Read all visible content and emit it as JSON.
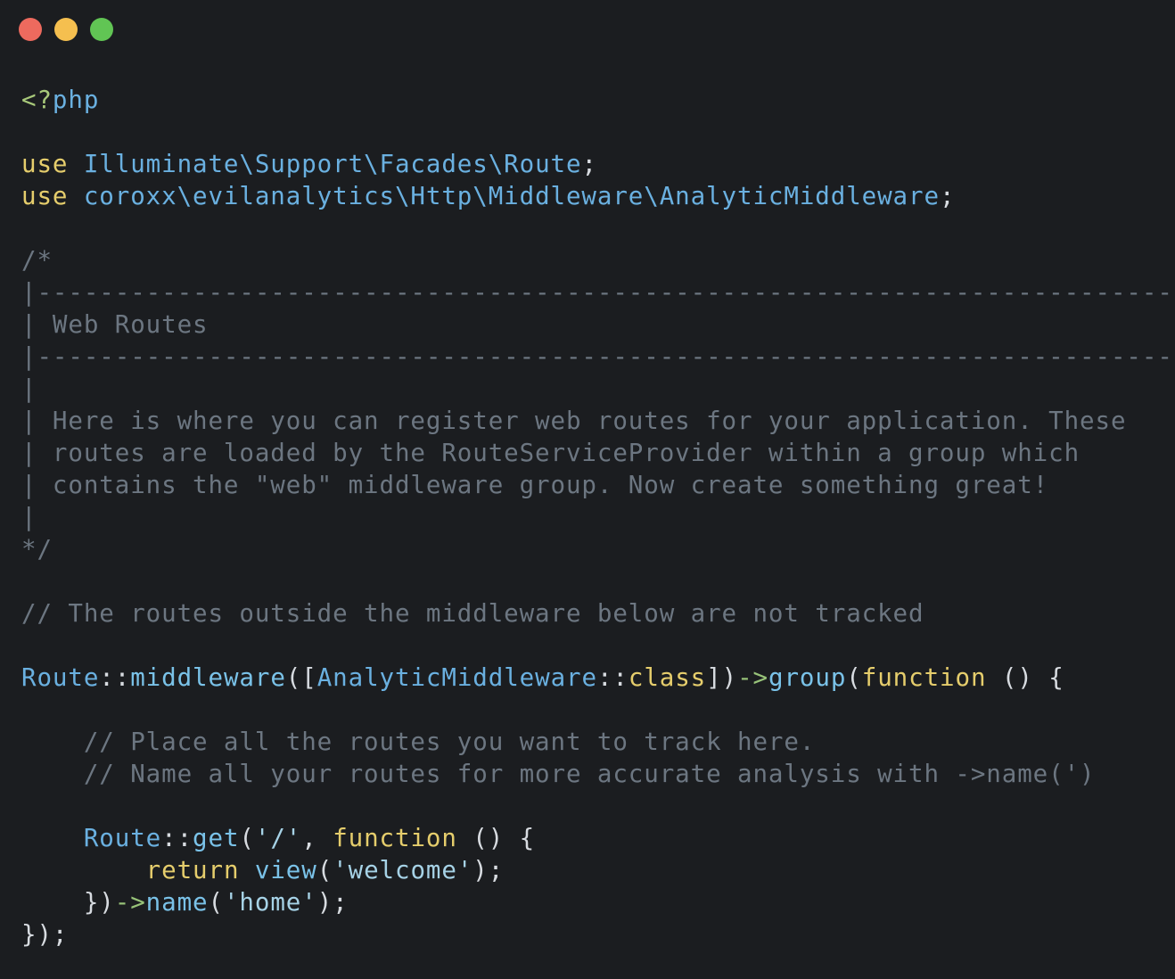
{
  "window": {
    "controls": [
      {
        "name": "close",
        "color": "#ed6a5e"
      },
      {
        "name": "minimize",
        "color": "#f5bf4f"
      },
      {
        "name": "zoom",
        "color": "#61c554"
      }
    ]
  },
  "colors": {
    "text": "#d7dbe0",
    "keyword": "#e5cd6c",
    "class": "#6ab0e0",
    "method": "#7ac2e8",
    "string": "#a6d2e6",
    "comment": "#6c7681",
    "operator": "#98c379",
    "php_tag": "#a8c97a",
    "function_kw": "#e5cd6c"
  },
  "code": {
    "lines": [
      [
        {
          "t": "<?",
          "c": "php_tag"
        },
        {
          "t": "php",
          "c": "class"
        }
      ],
      [],
      [
        {
          "t": "use ",
          "c": "keyword"
        },
        {
          "t": "Illuminate\\Support\\Facades\\Route",
          "c": "class"
        },
        {
          "t": ";",
          "c": "text"
        }
      ],
      [
        {
          "t": "use ",
          "c": "keyword"
        },
        {
          "t": "coroxx\\evilanalytics\\Http\\Middleware\\AnalyticMiddleware",
          "c": "class"
        },
        {
          "t": ";",
          "c": "text"
        }
      ],
      [],
      [
        {
          "t": "/*",
          "c": "comment"
        }
      ],
      [
        {
          "t": "|--------------------------------------------------------------------------",
          "c": "comment"
        }
      ],
      [
        {
          "t": "| Web Routes",
          "c": "comment"
        }
      ],
      [
        {
          "t": "|--------------------------------------------------------------------------",
          "c": "comment"
        }
      ],
      [
        {
          "t": "|",
          "c": "comment"
        }
      ],
      [
        {
          "t": "| Here is where you can register web routes for your application. These",
          "c": "comment"
        }
      ],
      [
        {
          "t": "| routes are loaded by the RouteServiceProvider within a group which",
          "c": "comment"
        }
      ],
      [
        {
          "t": "| contains the \"web\" middleware group. Now create something great!",
          "c": "comment"
        }
      ],
      [
        {
          "t": "|",
          "c": "comment"
        }
      ],
      [
        {
          "t": "*/",
          "c": "comment"
        }
      ],
      [],
      [
        {
          "t": "// The routes outside the middleware below are not tracked",
          "c": "comment"
        }
      ],
      [],
      [
        {
          "t": "Route",
          "c": "class"
        },
        {
          "t": "::",
          "c": "text"
        },
        {
          "t": "middleware",
          "c": "method"
        },
        {
          "t": "([",
          "c": "text"
        },
        {
          "t": "AnalyticMiddleware",
          "c": "class"
        },
        {
          "t": "::",
          "c": "text"
        },
        {
          "t": "class",
          "c": "keyword"
        },
        {
          "t": "])",
          "c": "text"
        },
        {
          "t": "->",
          "c": "operator"
        },
        {
          "t": "group",
          "c": "method"
        },
        {
          "t": "(",
          "c": "text"
        },
        {
          "t": "function",
          "c": "function_kw"
        },
        {
          "t": " () {",
          "c": "text"
        }
      ],
      [],
      [
        {
          "t": "    // Place all the routes you want to track here.",
          "c": "comment"
        }
      ],
      [
        {
          "t": "    // Name all your routes for more accurate analysis with ->name(')",
          "c": "comment"
        }
      ],
      [],
      [
        {
          "t": "    ",
          "c": "text"
        },
        {
          "t": "Route",
          "c": "class"
        },
        {
          "t": "::",
          "c": "text"
        },
        {
          "t": "get",
          "c": "method"
        },
        {
          "t": "(",
          "c": "text"
        },
        {
          "t": "'/'",
          "c": "string"
        },
        {
          "t": ", ",
          "c": "text"
        },
        {
          "t": "function",
          "c": "function_kw"
        },
        {
          "t": " () {",
          "c": "text"
        }
      ],
      [
        {
          "t": "        ",
          "c": "text"
        },
        {
          "t": "return",
          "c": "keyword"
        },
        {
          "t": " ",
          "c": "text"
        },
        {
          "t": "view",
          "c": "method"
        },
        {
          "t": "(",
          "c": "text"
        },
        {
          "t": "'welcome'",
          "c": "string"
        },
        {
          "t": ");",
          "c": "text"
        }
      ],
      [
        {
          "t": "    })",
          "c": "text"
        },
        {
          "t": "->",
          "c": "operator"
        },
        {
          "t": "name",
          "c": "method"
        },
        {
          "t": "(",
          "c": "text"
        },
        {
          "t": "'home'",
          "c": "string"
        },
        {
          "t": ");",
          "c": "text"
        }
      ],
      [
        {
          "t": "});",
          "c": "text"
        }
      ]
    ]
  }
}
